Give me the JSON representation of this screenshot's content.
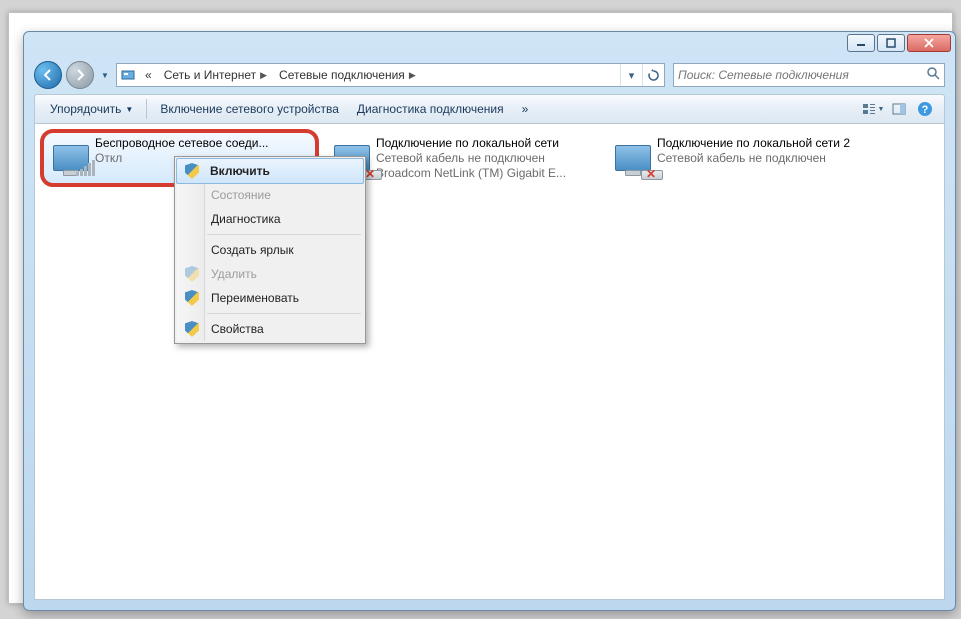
{
  "breadcrumb": {
    "prefix": "«",
    "segments": [
      "Сеть и Интернет",
      "Сетевые подключения"
    ]
  },
  "search": {
    "placeholder": "Поиск: Сетевые подключения"
  },
  "toolbar": {
    "organize": "Упорядочить",
    "enable_device": "Включение сетевого устройства",
    "diagnose": "Диагностика подключения",
    "more": "»"
  },
  "connections": [
    {
      "name": "Беспроводное сетевое соеди...",
      "status": "Откл",
      "detail": "",
      "type": "wifi",
      "badge": "x",
      "selected": true,
      "highlighted": true
    },
    {
      "name": "Подключение по локальной сети",
      "status": "Сетевой кабель не подключен",
      "detail": "Broadcom NetLink (TM) Gigabit E...",
      "type": "lan",
      "badge": "x",
      "selected": false
    },
    {
      "name": "Подключение по локальной сети 2",
      "status": "Сетевой кабель не подключен",
      "detail": "",
      "type": "lan",
      "badge": "x",
      "selected": false
    }
  ],
  "context_menu": {
    "enable": "Включить",
    "status": "Состояние",
    "diagnostics": "Диагностика",
    "create_shortcut": "Создать ярлык",
    "delete": "Удалить",
    "rename": "Переименовать",
    "properties": "Свойства"
  }
}
